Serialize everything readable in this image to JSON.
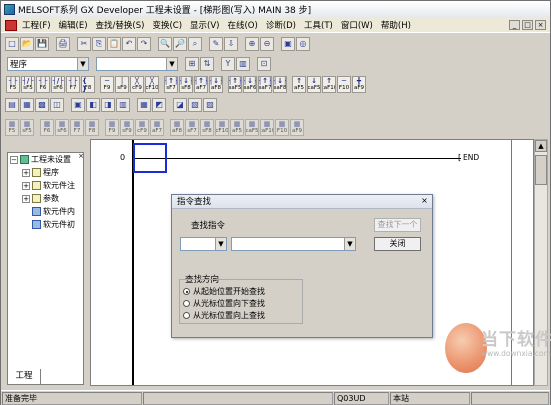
{
  "window": {
    "title": "MELSOFT系列 GX Developer 工程未设置 - [梯形图(写入)    MAIN    38 步]"
  },
  "menu": [
    "工程(F)",
    "编辑(E)",
    "查找/替换(S)",
    "变换(C)",
    "显示(V)",
    "在线(O)",
    "诊断(D)",
    "工具(T)",
    "窗口(W)",
    "帮助(H)"
  ],
  "mdi_controls": [
    "_",
    "□",
    "×"
  ],
  "toolbar1": {
    "icons": [
      "new",
      "open",
      "save",
      "print",
      "cut",
      "copy",
      "paste",
      "undo",
      "redo",
      "search",
      "device-search",
      "instruction-search",
      "write",
      "read",
      "zoom-in",
      "zoom-out",
      "monitor",
      "monitor-2"
    ],
    "glyphs": [
      "□",
      "📂",
      "💾",
      "🖨",
      "✂",
      "⎘",
      "📋",
      "↶",
      "↷",
      "🔍",
      "🔎",
      "⌕",
      "✎",
      "⇩",
      "⊕",
      "⊖",
      "▣",
      "◎"
    ]
  },
  "toolbar2": {
    "combo1_value": "程序",
    "combo2_value": "",
    "glyphs": [
      "⊞",
      "⇅",
      "Y",
      "▥",
      "⊡"
    ]
  },
  "ladder_keys": [
    {
      "g": "┤├",
      "k": "F5"
    },
    {
      "g": "┤/├",
      "k": "sF5"
    },
    {
      "g": "┤├",
      "k": "F6"
    },
    {
      "g": "┤/├",
      "k": "sF6"
    },
    {
      "g": "┤├",
      "k": "F7"
    },
    {
      "g": "{ }",
      "k": "F8"
    },
    {
      "g": "─",
      "k": "F9"
    },
    {
      "g": "│",
      "k": "sF9"
    },
    {
      "g": "╳",
      "k": "cF9"
    },
    {
      "g": "╳",
      "k": "cF10"
    },
    {
      "g": "┤↑├",
      "k": "sF7"
    },
    {
      "g": "┤↓├",
      "k": "sF8"
    },
    {
      "g": "┤↑├",
      "k": "aF7"
    },
    {
      "g": "┤↓├",
      "k": "aF8"
    },
    {
      "g": "┤↑├",
      "k": "saF5"
    },
    {
      "g": "┤↓├",
      "k": "saF6"
    },
    {
      "g": "┤↑├",
      "k": "saF7"
    },
    {
      "g": "┤↓├",
      "k": "saF8"
    },
    {
      "g": "↑",
      "k": "aF5"
    },
    {
      "g": "↓",
      "k": "caF5"
    },
    {
      "g": "↑",
      "k": "caF10"
    },
    {
      "g": "─",
      "k": "F10"
    },
    {
      "g": "╋",
      "k": "aF9"
    }
  ],
  "toolbar4_glyphs": [
    "▤",
    "▦",
    "▩",
    "◫",
    "▣",
    "◧",
    "◨",
    "▥",
    "▦",
    "◩",
    "◪",
    "▧",
    "▨"
  ],
  "toolbar4_keys": [
    "F5",
    "sF5",
    "F6",
    "sF6",
    "F7",
    "F8",
    "F9",
    "sF9",
    "cF9",
    "aF7",
    "aF8",
    "sF7",
    "sF8",
    "cF10",
    "aF5",
    "caF5",
    "caF10",
    "F10",
    "aF9"
  ],
  "tree": {
    "root": "工程未设置",
    "items": [
      {
        "label": "程序",
        "expander": "+"
      },
      {
        "label": "软元件注",
        "expander": "+"
      },
      {
        "label": "参数",
        "expander": "+"
      },
      {
        "label": "软元件内",
        "expander": ""
      },
      {
        "label": "软元件初",
        "expander": ""
      }
    ],
    "tab": "工程",
    "close": "×"
  },
  "ladder": {
    "step": "0",
    "end_label": "END"
  },
  "dialog": {
    "title": "指令查找",
    "close": "×",
    "find_label": "查找指令",
    "find_next": "查找下一个",
    "close_button": "关闭",
    "combo_a": "",
    "combo_b": "",
    "direction_label": "查找方向",
    "options": [
      "从起始位置开始查找",
      "从光标位置向下查找",
      "从光标位置向上查找"
    ],
    "selected": 0
  },
  "status": {
    "ready": "准备完毕",
    "cpu": "Q03UD",
    "station": "本站"
  },
  "watermark": {
    "text": "当下软件园",
    "url": "www.downxia.com"
  }
}
